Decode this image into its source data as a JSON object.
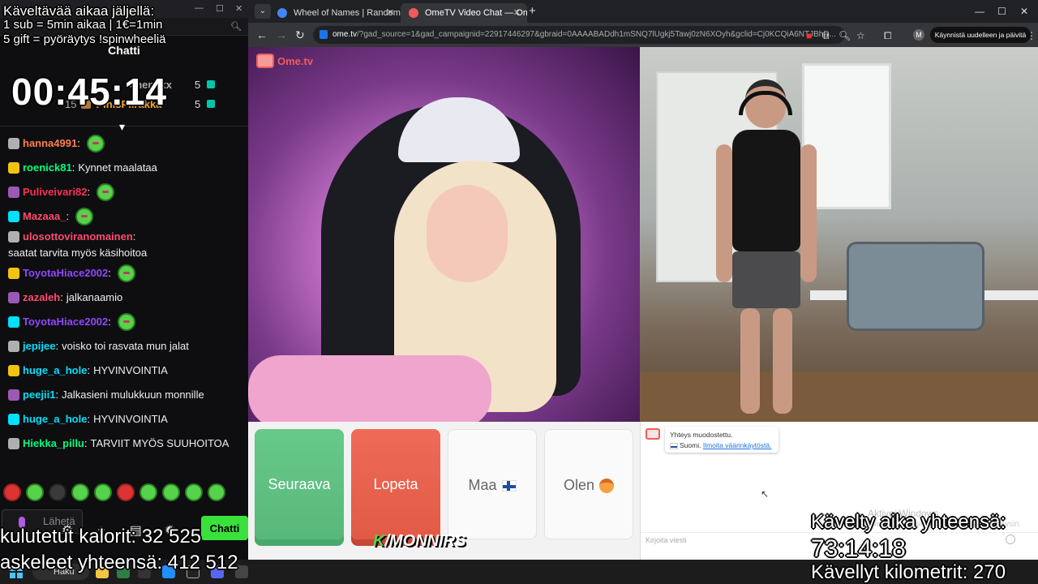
{
  "stream_overlay": {
    "goal_line1": "Käveltävää aikaa jäljellä:",
    "goal_line2": "1 sub = 5min aikaa | 1€=1min",
    "goal_line3": "5 gift = pyöräytys !spinwheeliä",
    "timer": "00:45:14",
    "calories": "kulutetut kalorit: 32 525",
    "steps": "askeleet yhteensä: 412 512",
    "walked_label": "Kävelty aika yhteensä:",
    "walked_time": "73:14:18",
    "km": "Kävellyt kilometrit: 270",
    "brand_k": "K",
    "brand": "/MONNIRS"
  },
  "chat_panel": {
    "title": "Chatti",
    "top_gifters": [
      {
        "name": "chen4xx",
        "count": "5"
      },
      {
        "name": "PinisPiirakka",
        "count": "5"
      },
      {
        "rank": "15"
      }
    ],
    "messages": [
      {
        "user": "hanna4991",
        "color": "#ff7f50",
        "text": "",
        "emote": true
      },
      {
        "user": "roenick81",
        "color": "#00ff7f",
        "text": "Kynnet maalataa",
        "emote": false
      },
      {
        "user": "Puliveivari82",
        "color": "#ff2d55",
        "text": "",
        "emote": true
      },
      {
        "user": "Mazaaa_",
        "color": "#ff4b6e",
        "text": "",
        "emote": true
      },
      {
        "user": "ulosottoviranomainen",
        "color": "#ff4b6e",
        "text": "saatat tarvita myös käsihoitoa",
        "emote": false
      },
      {
        "user": "ToyotaHiace2002",
        "color": "#9147ff",
        "text": "",
        "emote": true
      },
      {
        "user": "zazaleh",
        "color": "#ff4b6e",
        "text": "jalkanaamio",
        "emote": false
      },
      {
        "user": "ToyotaHiace2002",
        "color": "#9147ff",
        "text": "",
        "emote": true
      },
      {
        "user": "jepijee",
        "color": "#00e0ff",
        "text": "voisko toi rasvata mun jalat",
        "emote": false
      },
      {
        "user": "huge_a_hole",
        "color": "#00e0ff",
        "text": "HYVINVOINTIA",
        "emote": false
      },
      {
        "user": "peejii1",
        "color": "#00e0ff",
        "text": "Jalkasieni mulukkuun monnille",
        "emote": false
      },
      {
        "user": "huge_a_hole",
        "color": "#00e0ff",
        "text": "HYVINVOINTIA",
        "emote": false
      },
      {
        "user": "Hiekka_pillu",
        "color": "#00ff7f",
        "text": "TARVIIT MYÖS SUUHOITOA",
        "emote": false
      }
    ],
    "input_placeholder": "Lähetä",
    "send_label": "Chatti"
  },
  "browser": {
    "tabs": [
      {
        "title": "Wheel of Names | Random nam",
        "active": false,
        "fav_color": "#4285f4"
      },
      {
        "title": "OmeTV Video Chat — Ome",
        "active": true,
        "fav_color": "#f15b5b"
      }
    ],
    "url_host": "ome.tv",
    "url_rest": "/?gad_source=1&gad_campaignid=22917446297&gbraid=0AAAABADdh1mSNQ7lUgkj5Tawj0zN6XOyh&gclid=Cj0KCQiA6NTJBhD...",
    "profile_initial": "M",
    "restart_label": "Käynnistä uudelleen ja päivitä"
  },
  "ometv": {
    "logo": "Ome.tv",
    "buttons": {
      "next": "Seuraava",
      "stop": "Lopeta",
      "country": "Maa",
      "gender": "Olen"
    },
    "system_message": {
      "line1": "Yhteys muodostettu.",
      "country": "Suomi.",
      "report_link": "Ilmoita väärinkäytöstä."
    },
    "watermark1": "Aktivoi Windows",
    "watermark2": "Siirry Asetuksiin aktivoidaksesi Windowsin.",
    "message_placeholder": "Kirjoita viesti"
  },
  "taskbar": {
    "search_label": "Haku"
  },
  "colors": {
    "twitch_bg": "#0e0e10",
    "accent_green": "#3ae13c",
    "next_green": "#58b87b",
    "stop_red": "#e15a46",
    "ometv_red": "#f15b5b"
  }
}
